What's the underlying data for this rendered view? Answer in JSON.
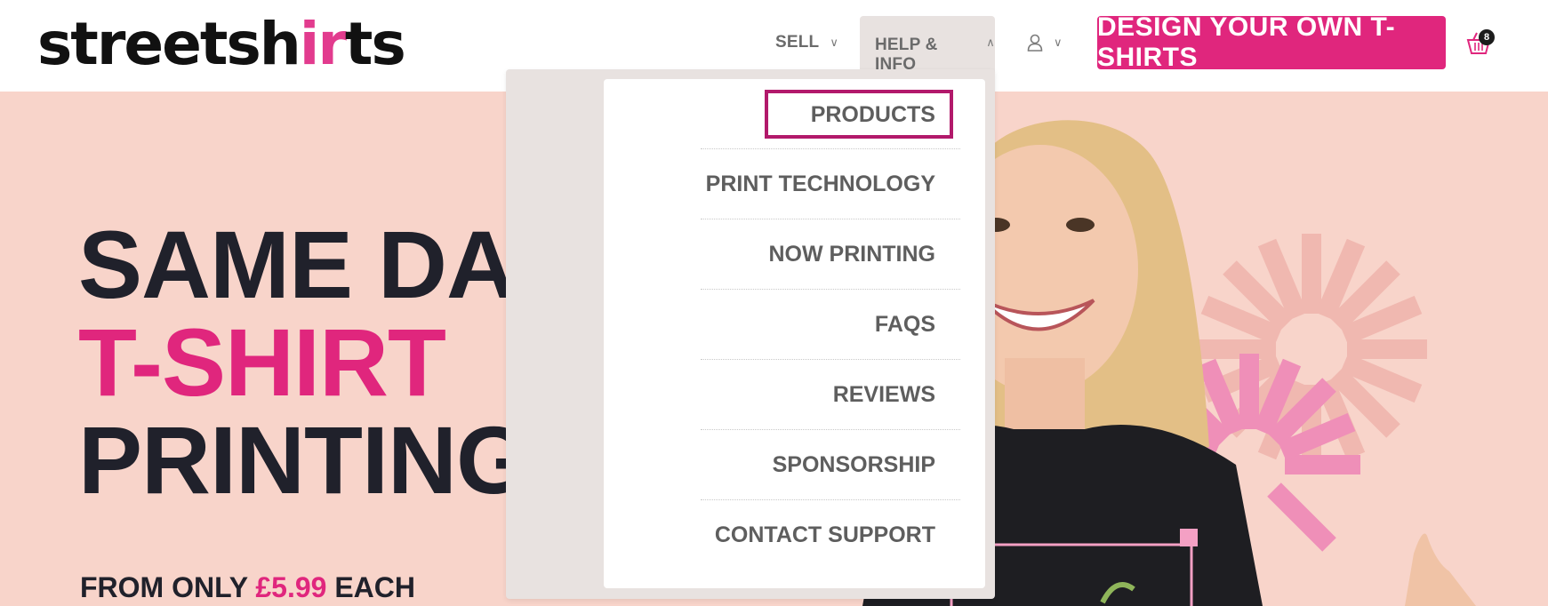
{
  "header": {
    "logo_text_start": "streetsh",
    "logo_text_accent": "ir",
    "logo_text_end": "ts",
    "nav": {
      "sell_label": "SELL",
      "help_label": "HELP & INFO"
    },
    "cta_label": "DESIGN YOUR OWN T-SHIRTS",
    "basket_count": "8"
  },
  "dropdown": {
    "items": [
      {
        "label": "PRODUCTS"
      },
      {
        "label": "PRINT TECHNOLOGY"
      },
      {
        "label": "NOW PRINTING"
      },
      {
        "label": "FAQS"
      },
      {
        "label": "REVIEWS"
      },
      {
        "label": "SPONSORSHIP"
      },
      {
        "label": "CONTACT SUPPORT"
      }
    ]
  },
  "hero": {
    "line1": "SAME DAY",
    "line2": "T-SHIRT",
    "line3": "PRINTING!",
    "price_prefix": "FROM ONLY",
    "price_value": "£5.99",
    "price_suffix": "EACH"
  },
  "colors": {
    "brand_pink": "#e0267d",
    "hero_bg": "#f8d4ca",
    "dropdown_bg": "#e8e2e0",
    "active_outline": "#b2196b"
  }
}
